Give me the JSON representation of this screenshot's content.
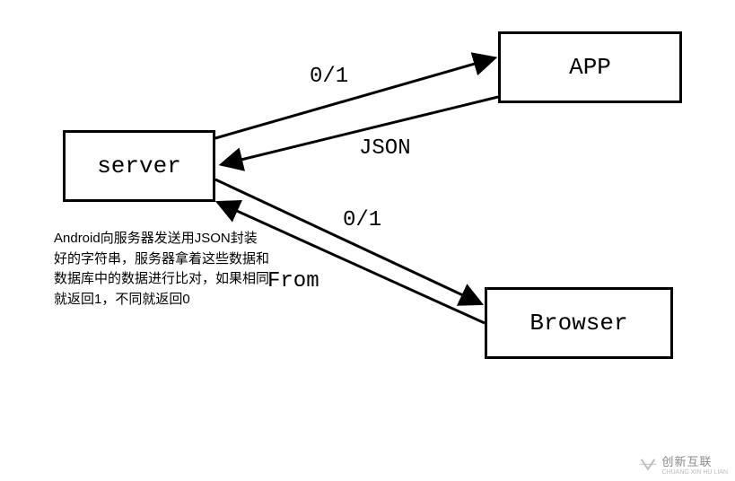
{
  "nodes": {
    "server": "server",
    "app": "APP",
    "browser": "Browser"
  },
  "edges": {
    "top01": "0/1",
    "json": "JSON",
    "bottom01": "0/1",
    "from": "From"
  },
  "description": "Android向服务器发送用JSON封装好的字符串，服务器拿着这些数据和数据库中的数据进行比对，如果相同就返回1，不同就返回0",
  "watermark": {
    "brand": "创新互联",
    "sub": "CHUANG XIN HU LIAN"
  }
}
